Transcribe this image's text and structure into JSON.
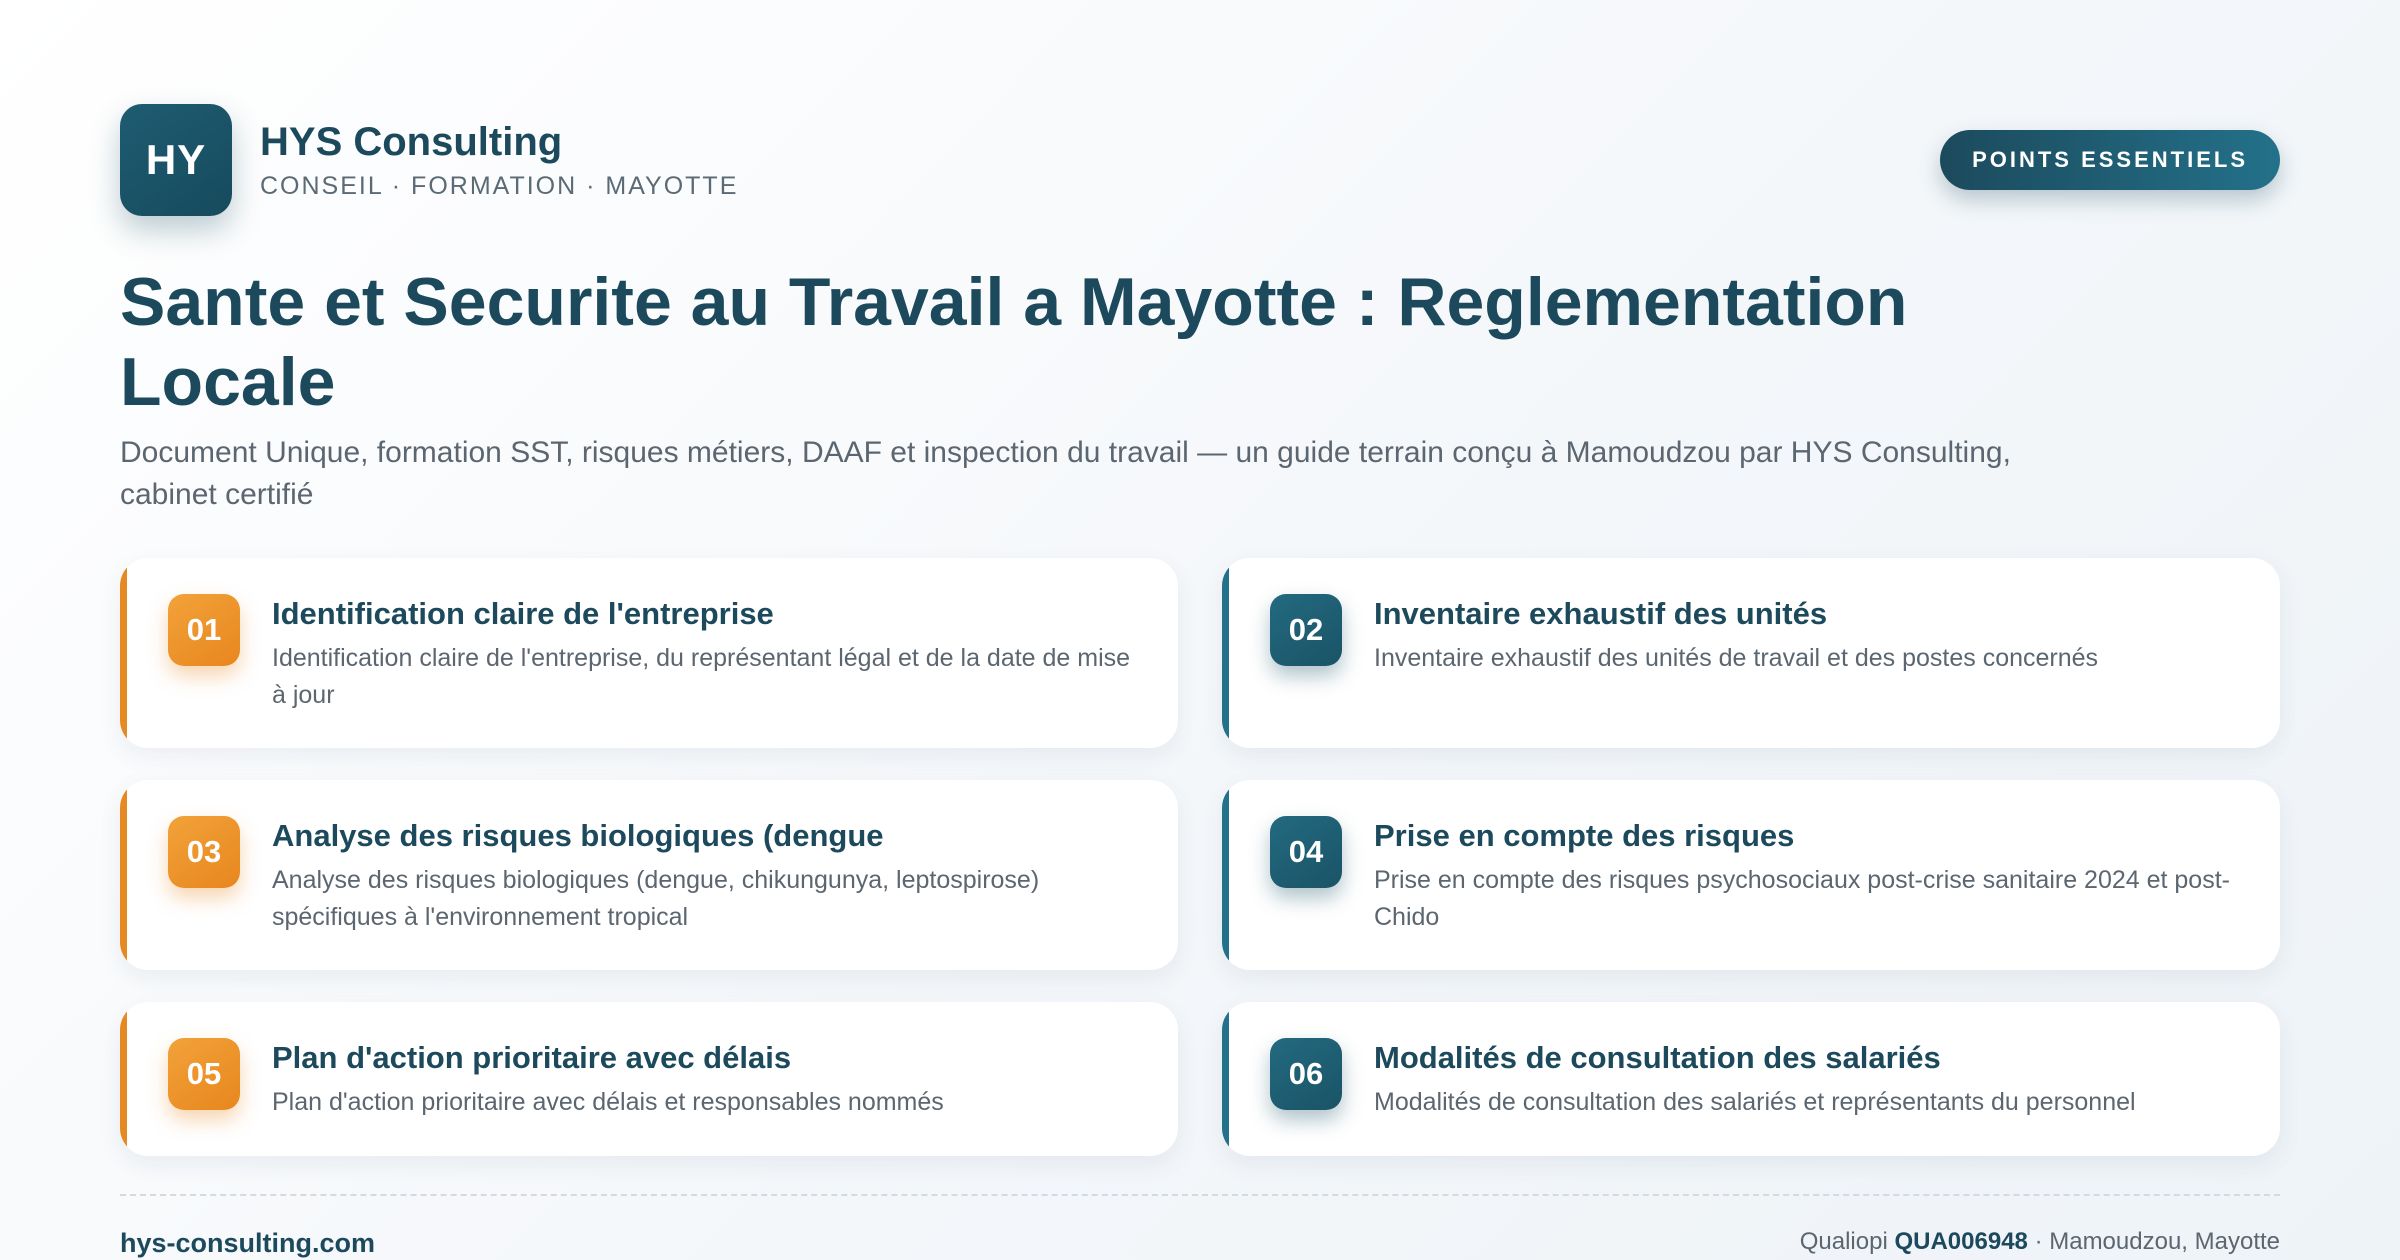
{
  "brand": {
    "logo_text": "HY",
    "name": "HYS Consulting",
    "tagline": "CONSEIL · FORMATION · MAYOTTE"
  },
  "badge": "POINTS ESSENTIELS",
  "title": "Sante et Securite au Travail a Mayotte : Reglementation Locale",
  "subtitle": "Document Unique, formation SST, risques métiers, DAAF et inspection du travail — un guide terrain conçu à Mamoudzou par HYS Consulting, cabinet certifié",
  "cards": [
    {
      "num": "01",
      "title": "Identification claire de l'entreprise",
      "desc": "Identification claire de l'entreprise, du représentant légal et de la date de mise à jour",
      "accent": "orange"
    },
    {
      "num": "02",
      "title": "Inventaire exhaustif des unités",
      "desc": "Inventaire exhaustif des unités de travail et des postes concernés",
      "accent": "teal"
    },
    {
      "num": "03",
      "title": "Analyse des risques biologiques (dengue",
      "desc": "Analyse des risques biologiques (dengue, chikungunya, leptospirose) spécifiques à l'environnement tropical",
      "accent": "orange"
    },
    {
      "num": "04",
      "title": "Prise en compte des risques",
      "desc": "Prise en compte des risques psychosociaux post-crise sanitaire 2024 et post-Chido",
      "accent": "teal"
    },
    {
      "num": "05",
      "title": "Plan d'action prioritaire avec délais",
      "desc": "Plan d'action prioritaire avec délais et responsables nommés",
      "accent": "orange"
    },
    {
      "num": "06",
      "title": "Modalités de consultation des salariés",
      "desc": "Modalités de consultation des salariés et représentants du personnel",
      "accent": "teal"
    }
  ],
  "footer": {
    "website": "hys-consulting.com",
    "cert_label": "Qualiopi",
    "cert_code": "QUA006948",
    "location": "· Mamoudzou, Mayotte"
  },
  "colors": {
    "primary": "#1c4a5c",
    "accent_orange": "#e8861e",
    "accent_teal": "#23718a"
  }
}
